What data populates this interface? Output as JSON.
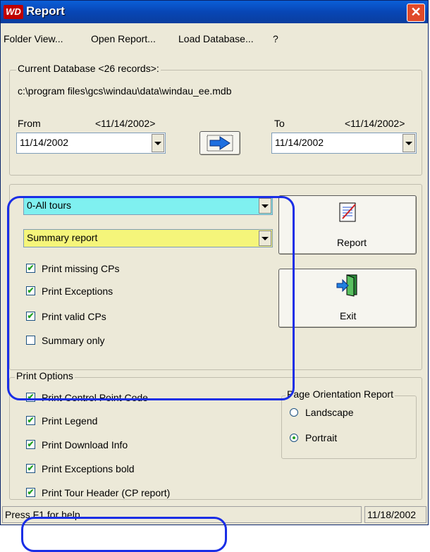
{
  "window": {
    "title": "Report",
    "icon_text": "WD"
  },
  "menu": [
    "Folder View...",
    "Open Report...",
    "Load Database...",
    "?"
  ],
  "database": {
    "group_label": "Current Database <26 records>:",
    "path": "c:\\program files\\gcs\\windau\\data\\windau_ee.mdb",
    "from_label": "From",
    "from_hint": "<11/14/2002>",
    "from_value": "11/14/2002",
    "to_label": "To",
    "to_hint": "<11/14/2002>",
    "to_value": "11/14/2002"
  },
  "report_options": {
    "tour_select": "0-All tours",
    "report_type": "Summary report",
    "checkboxes": [
      {
        "label": "Print missing CPs",
        "checked": true
      },
      {
        "label": "Print Exceptions",
        "checked": true
      },
      {
        "label": "Print valid CPs",
        "checked": true
      },
      {
        "label": "Summary only",
        "checked": false
      }
    ],
    "report_button": "Report",
    "exit_button": "Exit"
  },
  "print_options": {
    "group_label": "Print Options",
    "checkboxes": [
      {
        "label": "Print Control Point Code",
        "checked": true
      },
      {
        "label": "Print Legend",
        "checked": true
      },
      {
        "label": "Print Download Info",
        "checked": true
      },
      {
        "label": "Print Exceptions bold",
        "checked": true
      },
      {
        "label": "Print Tour Header (CP report)",
        "checked": true
      }
    ],
    "orientation": {
      "group_label": "Page Orientation Report",
      "options": [
        {
          "label": "Landscape",
          "selected": false
        },
        {
          "label": "Portrait",
          "selected": true
        }
      ]
    }
  },
  "status": {
    "help_text": "Press F1 for help",
    "date": "11/18/2002"
  },
  "colors": {
    "tour_select_bg": "#7ff0f0",
    "report_type_bg": "#f5f57a",
    "annotation": "#1a2ee6"
  }
}
